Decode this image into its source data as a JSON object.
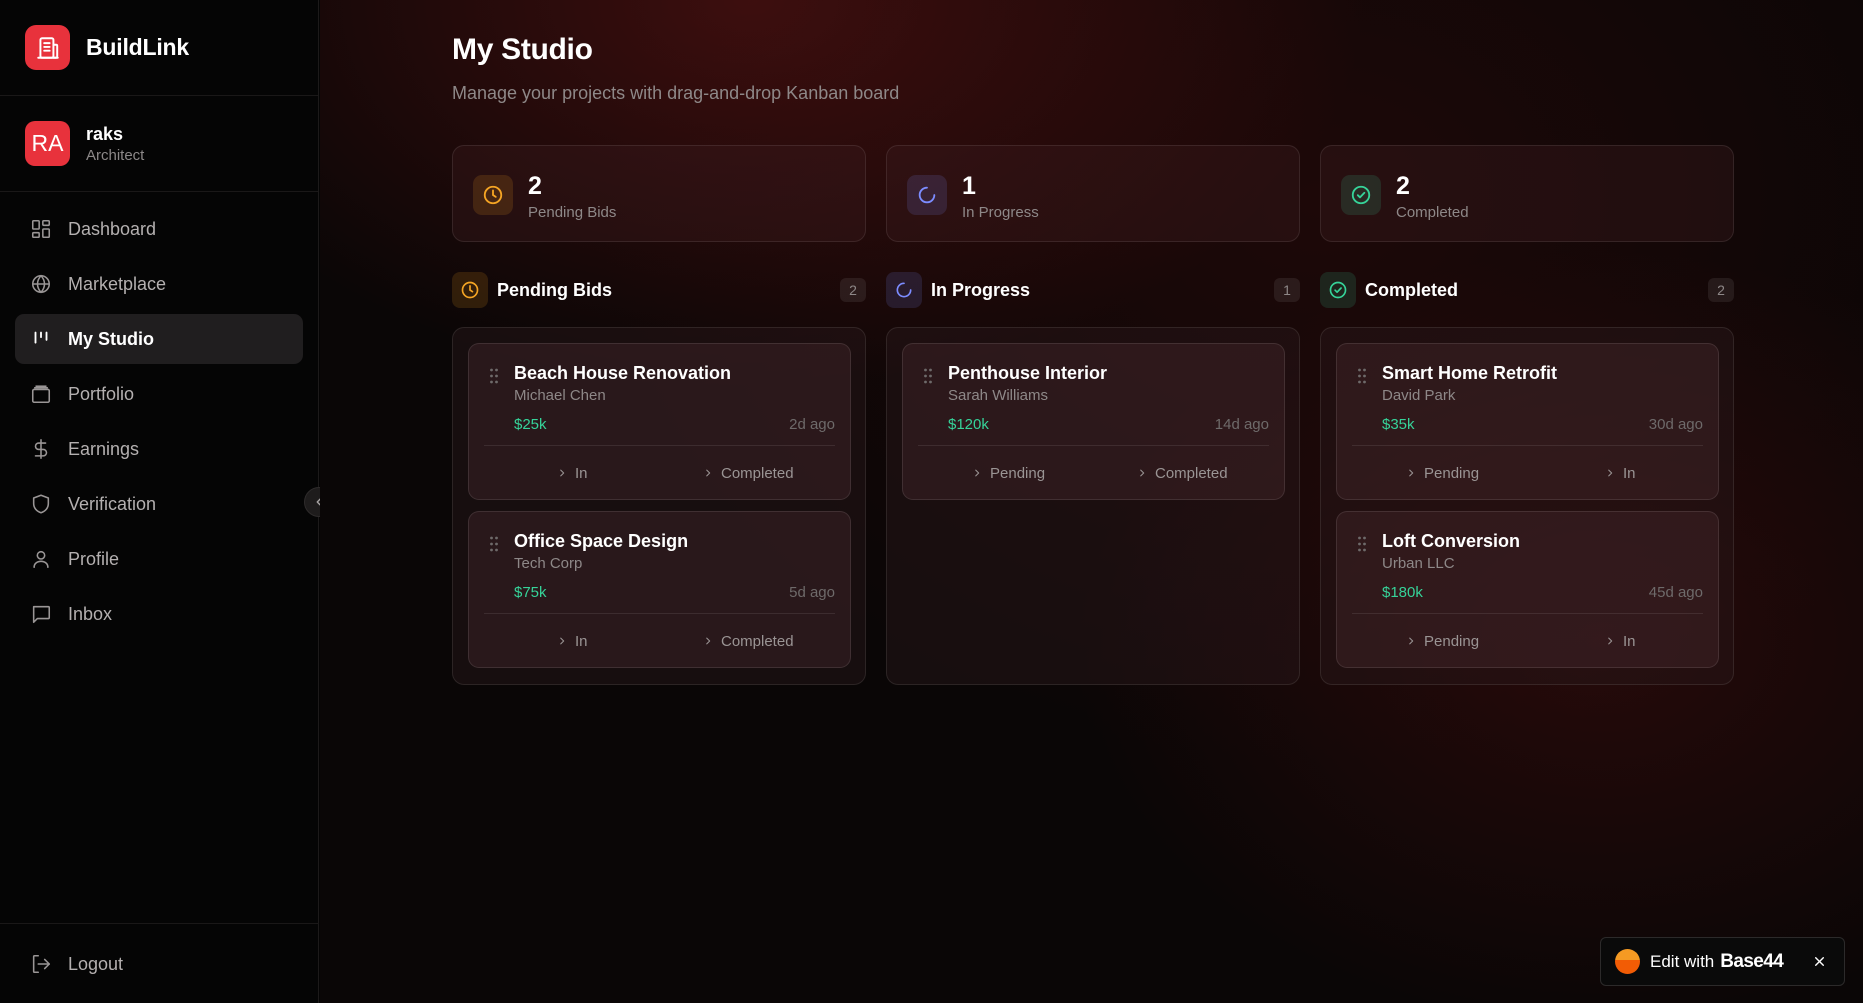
{
  "app": {
    "name": "BuildLink",
    "logo_icon": "building-icon"
  },
  "user": {
    "initials": "RA",
    "name": "raks",
    "role": "Architect"
  },
  "nav": {
    "items": [
      {
        "label": "Dashboard",
        "icon": "grid-icon"
      },
      {
        "label": "Marketplace",
        "icon": "globe-icon"
      },
      {
        "label": "My Studio",
        "icon": "kanban-icon",
        "active": true
      },
      {
        "label": "Portfolio",
        "icon": "portfolio-icon"
      },
      {
        "label": "Earnings",
        "icon": "dollar-icon"
      },
      {
        "label": "Verification",
        "icon": "shield-icon"
      },
      {
        "label": "Profile",
        "icon": "user-icon"
      },
      {
        "label": "Inbox",
        "icon": "message-icon"
      }
    ],
    "logout_label": "Logout"
  },
  "page": {
    "title": "My Studio",
    "subtitle": "Manage your projects with drag-and-drop Kanban board"
  },
  "stats": [
    {
      "value": "2",
      "label": "Pending Bids",
      "icon": "clock-icon",
      "color": "#f5a524"
    },
    {
      "value": "1",
      "label": "In Progress",
      "icon": "loader-icon",
      "color": "#7c8cff"
    },
    {
      "value": "2",
      "label": "Completed",
      "icon": "check-circle-icon",
      "color": "#36d399"
    }
  ],
  "columns": [
    {
      "title": "Pending Bids",
      "count": "2",
      "icon": "clock-icon",
      "cards": [
        {
          "title": "Beach House Renovation",
          "client": "Michael Chen",
          "price": "$25k",
          "age": "2d ago",
          "actions": [
            "In",
            "Completed"
          ]
        },
        {
          "title": "Office Space Design",
          "client": "Tech Corp",
          "price": "$75k",
          "age": "5d ago",
          "actions": [
            "In",
            "Completed"
          ]
        }
      ]
    },
    {
      "title": "In Progress",
      "count": "1",
      "icon": "loader-icon",
      "cards": [
        {
          "title": "Penthouse Interior",
          "client": "Sarah Williams",
          "price": "$120k",
          "age": "14d ago",
          "actions": [
            "Pending",
            "Completed"
          ]
        }
      ]
    },
    {
      "title": "Completed",
      "count": "2",
      "icon": "check-circle-icon",
      "cards": [
        {
          "title": "Smart Home Retrofit",
          "client": "David Park",
          "price": "$35k",
          "age": "30d ago",
          "actions": [
            "Pending",
            "In"
          ]
        },
        {
          "title": "Loft Conversion",
          "client": "Urban LLC",
          "price": "$180k",
          "age": "45d ago",
          "actions": [
            "Pending",
            "In"
          ]
        }
      ]
    }
  ],
  "badge": {
    "prefix": "Edit with",
    "brand": "Base44"
  },
  "colors": {
    "accent": "#e8323c",
    "price": "#36d399"
  }
}
